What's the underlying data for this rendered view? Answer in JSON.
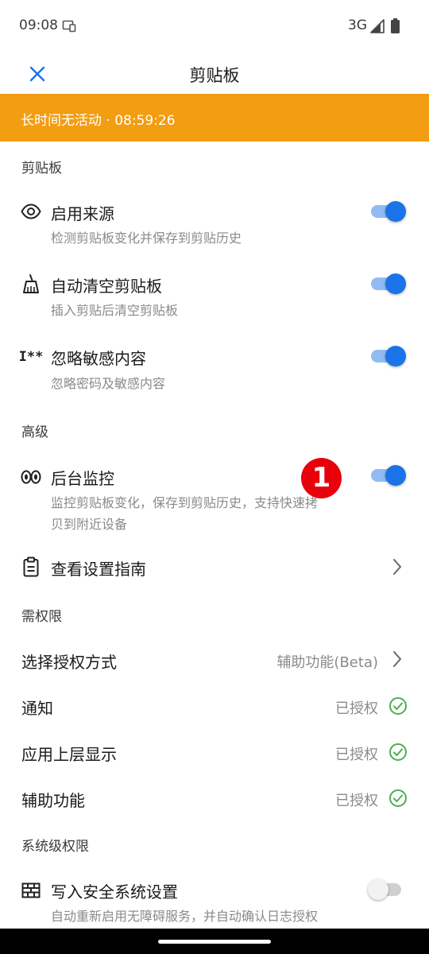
{
  "status_bar": {
    "time": "09:08",
    "network": "3G",
    "icons": [
      "cast-icon",
      "signal-icon",
      "battery-icon"
    ]
  },
  "app_bar": {
    "title": "剪贴板",
    "close_icon": "close-icon"
  },
  "banner": {
    "text": "长时间无活动 · 08:59:26",
    "color": "#F29D12"
  },
  "sections": {
    "clipboard": "剪贴板",
    "advanced": "高级",
    "permissions": "需权限",
    "system": "系统级权限"
  },
  "clipboard_items": [
    {
      "icon": "eye-icon",
      "title": "启用来源",
      "subtitle": "检测剪贴板变化并保存到剪贴历史",
      "enabled": true
    },
    {
      "icon": "broom-icon",
      "title": "自动清空剪贴板",
      "subtitle": "插入剪贴后清空剪贴板",
      "enabled": true
    },
    {
      "icon": "password-mask-icon",
      "title": "忽略敏感内容",
      "subtitle": "忽略密码及敏感内容",
      "enabled": true
    }
  ],
  "advanced": {
    "monitor": {
      "icon": "binoculars-icon",
      "title": "后台监控",
      "subtitle_line1": "监控剪贴板变化，保存到剪贴历史，支持快速拷",
      "subtitle_line2": "贝到附近设备",
      "enabled": true
    },
    "guide": {
      "icon": "clipboard-list-icon",
      "title": "查看设置指南"
    }
  },
  "permissions": [
    {
      "title": "选择授权方式",
      "value": "辅助功能(Beta)",
      "indicator": "chevron-right-icon"
    },
    {
      "title": "通知",
      "value": "已授权",
      "indicator": "check-circle-icon"
    },
    {
      "title": "应用上层显示",
      "value": "已授权",
      "indicator": "check-circle-icon"
    },
    {
      "title": "辅助功能",
      "value": "已授权",
      "indicator": "check-circle-icon"
    }
  ],
  "system": {
    "icon": "firewall-icon",
    "title": "写入安全系统设置",
    "subtitle": "自动重新启用无障碍服务，并自动确认日志授权",
    "enabled": false
  },
  "annotation_badge": "1",
  "colors": {
    "accent": "#1A73E8",
    "toggle_track_on": "#91BBF2",
    "check_green": "#4CAF50",
    "badge_red": "#E8000B"
  }
}
